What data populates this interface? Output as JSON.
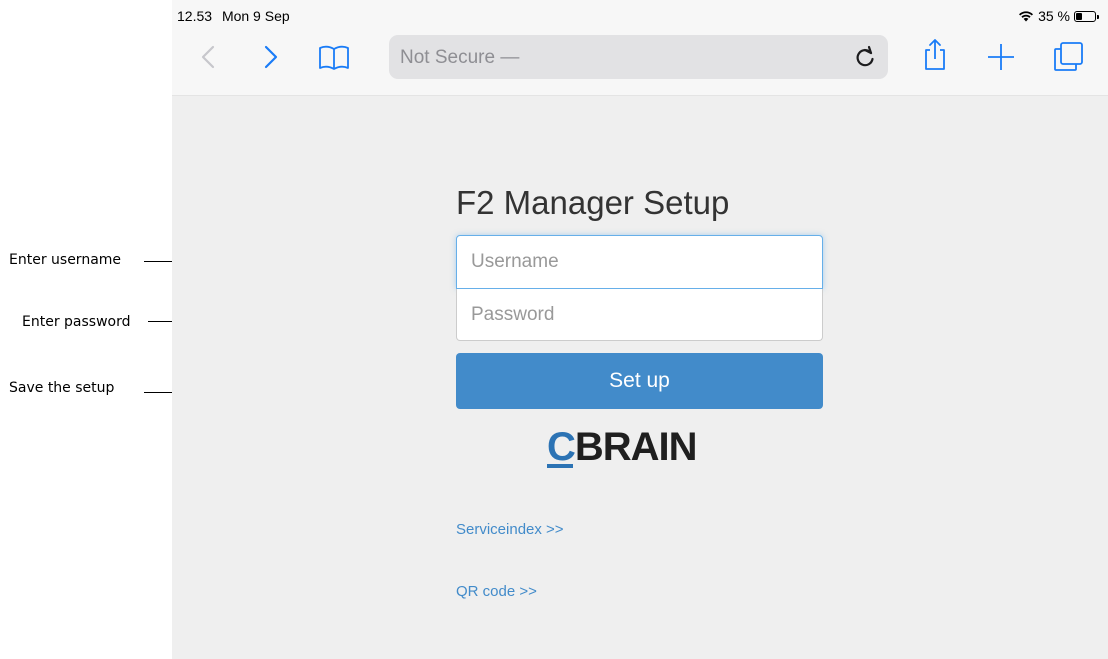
{
  "callouts": {
    "username": "Enter username",
    "password": "Enter password",
    "setup": "Save the setup"
  },
  "status_bar": {
    "time": "12.53",
    "date": "Mon 9 Sep",
    "battery": "35 %",
    "battery_level": 0.35
  },
  "browser": {
    "address_text": "Not Secure —",
    "icons": [
      "back-icon",
      "forward-icon",
      "bookmarks-icon",
      "reload-icon",
      "share-icon",
      "new-tab-icon",
      "tabs-icon"
    ]
  },
  "page": {
    "title": "F2 Manager Setup",
    "username_placeholder": "Username",
    "password_placeholder": "Password",
    "setup_button": "Set up",
    "logo_c": "C",
    "logo_rest": "BRAIN",
    "serviceindex_link": "Serviceindex >>",
    "qr_link": "QR code >>"
  },
  "colors": {
    "accent": "#428bca",
    "focus_border": "#66afe9",
    "browser_blue": "#1a7cf7",
    "page_bg": "#efefef"
  }
}
